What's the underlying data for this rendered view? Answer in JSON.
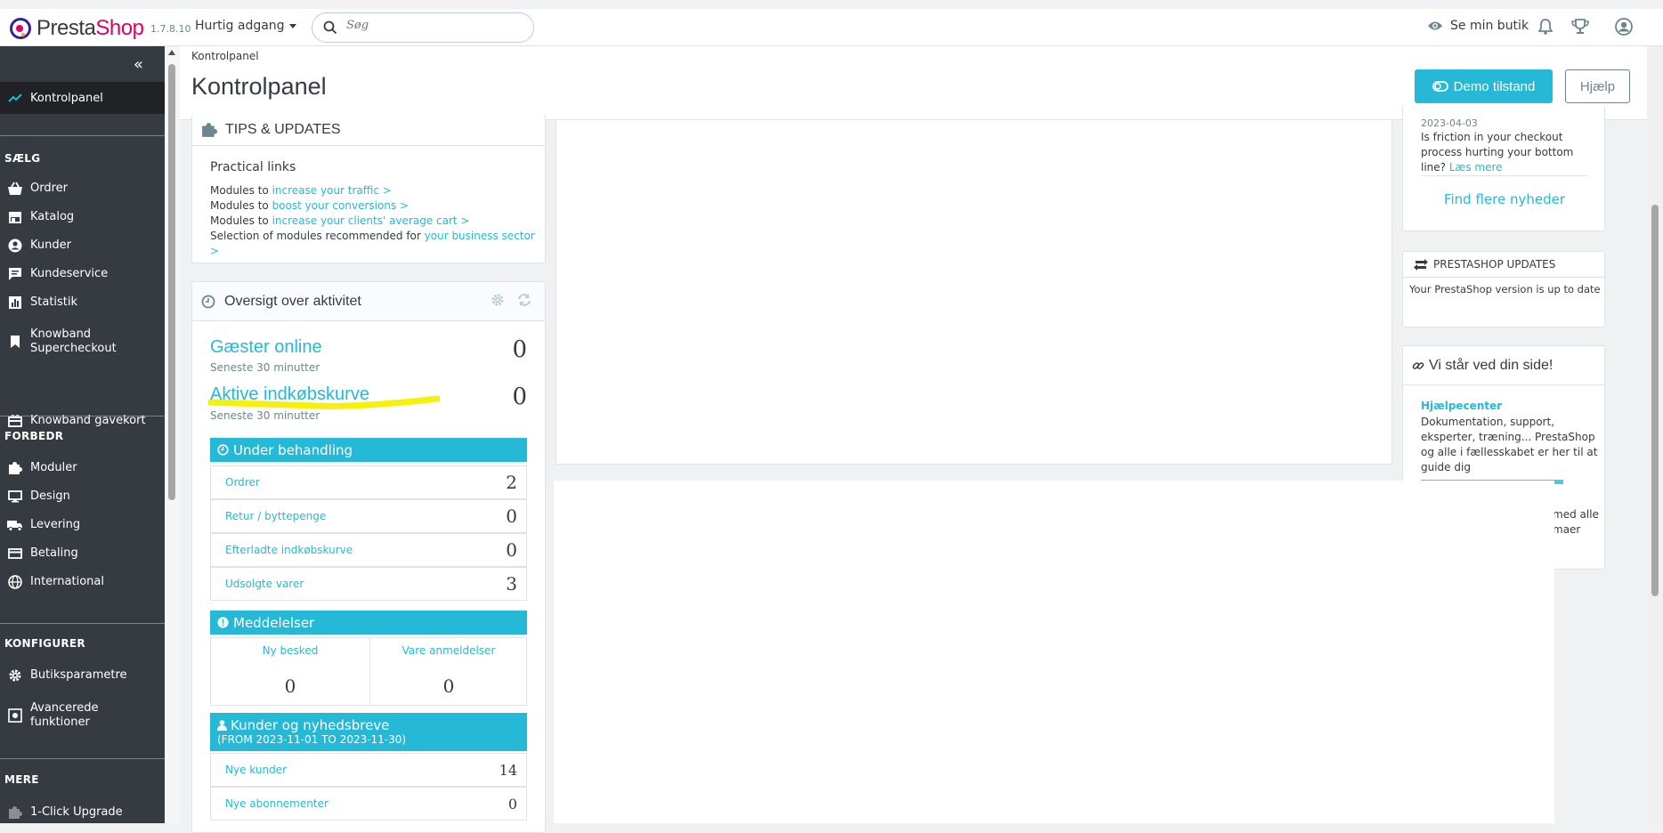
{
  "app": {
    "logo_prefix": "Presta",
    "logo_suffix": "Shop",
    "version": "1.7.8.10",
    "quick_access": "Hurtig adgang",
    "search_placeholder": "Søg",
    "view_shop": "Se min butik"
  },
  "sidebar": {
    "active_item": "Kontrolpanel",
    "sections": {
      "sell": "SÆLG",
      "improve": "FORBEDR",
      "configure": "KONFIGURER",
      "more": "MERE"
    },
    "sell_items": [
      "Ordrer",
      "Katalog",
      "Kunder",
      "Kundeservice",
      "Statistik",
      "Knowband Supercheckout",
      "Knowband gavekort"
    ],
    "improve_items": [
      "Moduler",
      "Design",
      "Levering",
      "Betaling",
      "International"
    ],
    "configure_items": [
      "Butiksparametre",
      "Avancerede funktioner"
    ],
    "more_items": [
      "1-Click Upgrade"
    ]
  },
  "header": {
    "breadcrumb": "Kontrolpanel",
    "title": "Kontrolpanel",
    "demo_button": "Demo tilstand",
    "help_button": "Hjælp"
  },
  "tips": {
    "title": "TIPS & UPDATES",
    "subtitle": "Practical links",
    "links": [
      {
        "prefix": "Modules to ",
        "link": "increase your traffic >"
      },
      {
        "prefix": "Modules to ",
        "link": "boost your conversions >"
      },
      {
        "prefix": "Modules to ",
        "link": "increase your clients' average cart >"
      },
      {
        "prefix": "Selection of modules recommended for ",
        "link": "your business sector >"
      }
    ]
  },
  "activity": {
    "title": "Oversigt over aktivitet",
    "guests_label": "Gæster online",
    "guests_sub": "Seneste 30 minutter",
    "guests_value": "0",
    "carts_label": "Aktive indkøbskurve",
    "carts_sub": "Seneste 30 minutter",
    "carts_value": "0",
    "pending_title": "Under behandling",
    "pending_rows": [
      {
        "label": "Ordrer",
        "value": "2"
      },
      {
        "label": "Retur / byttepenge",
        "value": "0"
      },
      {
        "label": "Efterladte indkøbskurve",
        "value": "0"
      },
      {
        "label": "Udsolgte varer",
        "value": "3"
      }
    ],
    "notifications_title": "Meddelelser",
    "new_messages_label": "Ny besked",
    "new_messages_value": "0",
    "reviews_label": "Vare anmeldelser",
    "reviews_value": "0",
    "customers_title": "Kunder og nyhedsbreve",
    "customers_range": "(FROM 2023-11-01 TO 2023-11-30)",
    "customers_rows": [
      {
        "label": "Nye kunder",
        "value": "14"
      },
      {
        "label": "Nye abonnementer",
        "value": "0"
      }
    ]
  },
  "news": {
    "date": "2023-04-03",
    "text": "Is friction in your checkout process hurting your bottom line?",
    "read_more": "Læs mere",
    "find_more": "Find flere nyheder"
  },
  "updates": {
    "title": "PRESTASHOP UPDATES",
    "text": "Your PrestaShop version is up to date"
  },
  "support": {
    "title": "Vi står ved din side!",
    "help_center": "Hjælpecenter",
    "help_text": "Dokumentation, support, eksperter, træning... PrestaShop og alle i fællesskabet er her til at guide dig",
    "partial_text_1": "med alle",
    "partial_text_2": "maer"
  },
  "colors": {
    "accent": "#25b9d7",
    "sidebar": "#363a41",
    "highlight": "#f4f000"
  }
}
